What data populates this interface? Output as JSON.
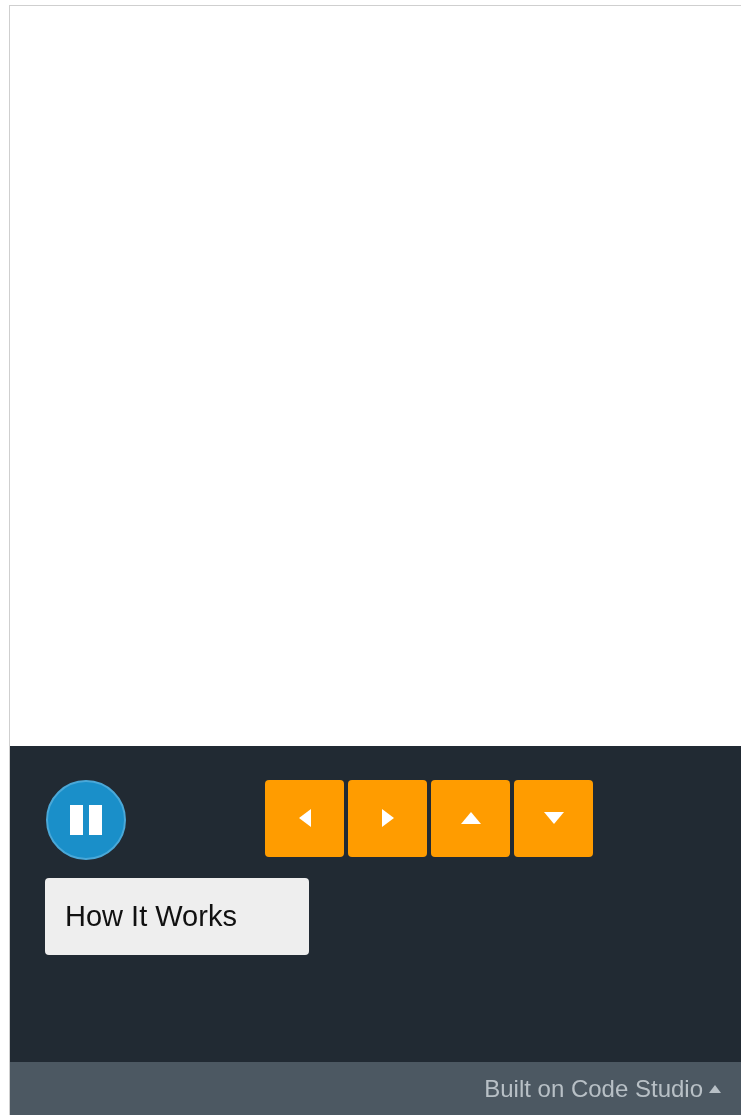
{
  "run_button": {
    "playing": true
  },
  "arrow_buttons": [
    {
      "kind": "left"
    },
    {
      "kind": "right"
    },
    {
      "kind": "up"
    },
    {
      "kind": "down"
    }
  ],
  "info_button": {
    "label": "How It Works"
  },
  "footer": {
    "label": "Built on Code Studio"
  }
}
